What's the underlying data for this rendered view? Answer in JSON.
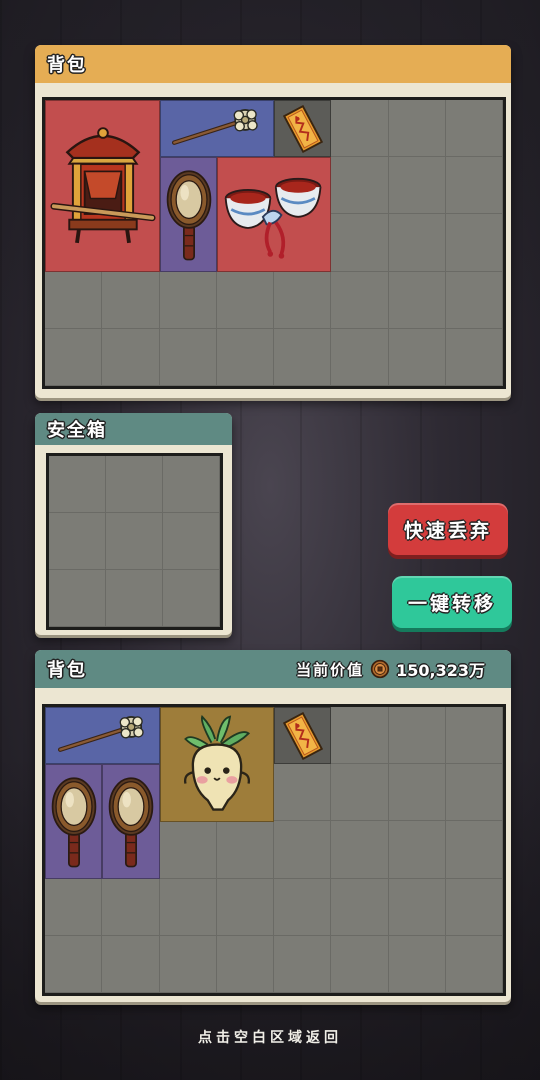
{
  "colors": {
    "top_header": "#e5ad54",
    "teal_header": "#5f8a83",
    "item_red": "#c24e4e",
    "item_blue": "#5965a6",
    "item_purple": "#6d5c98",
    "item_gold": "#9e7d3a",
    "item_grey": "#5c5c58",
    "discard_button": "#d33c3c",
    "transfer_button": "#2fc89a"
  },
  "top_backpack": {
    "title": "背包",
    "items": [
      {
        "icon": "sedan-chair-icon",
        "rarity": "red"
      },
      {
        "icon": "hairpin-icon",
        "rarity": "blue"
      },
      {
        "icon": "talisman-icon",
        "rarity": "grey"
      },
      {
        "icon": "hand-mirror-icon",
        "rarity": "purple"
      },
      {
        "icon": "porcelain-cups-icon",
        "rarity": "red"
      }
    ]
  },
  "safe_box": {
    "title": "安全箱"
  },
  "actions": {
    "quick_discard": "快速丢弃",
    "one_key_transfer": "一键转移"
  },
  "bottom_backpack": {
    "title": "背包",
    "value_label": "当前价值",
    "value_currency_icon": "copper-coin-icon",
    "value_amount": "150,323万",
    "items": [
      {
        "icon": "hairpin-icon",
        "rarity": "blue"
      },
      {
        "icon": "mandrake-creature-icon",
        "rarity": "gold"
      },
      {
        "icon": "talisman-icon",
        "rarity": "grey"
      },
      {
        "icon": "hand-mirror-icon",
        "rarity": "purple"
      },
      {
        "icon": "hand-mirror-icon",
        "rarity": "purple"
      }
    ]
  },
  "footer": {
    "hint": "点击空白区域返回"
  }
}
